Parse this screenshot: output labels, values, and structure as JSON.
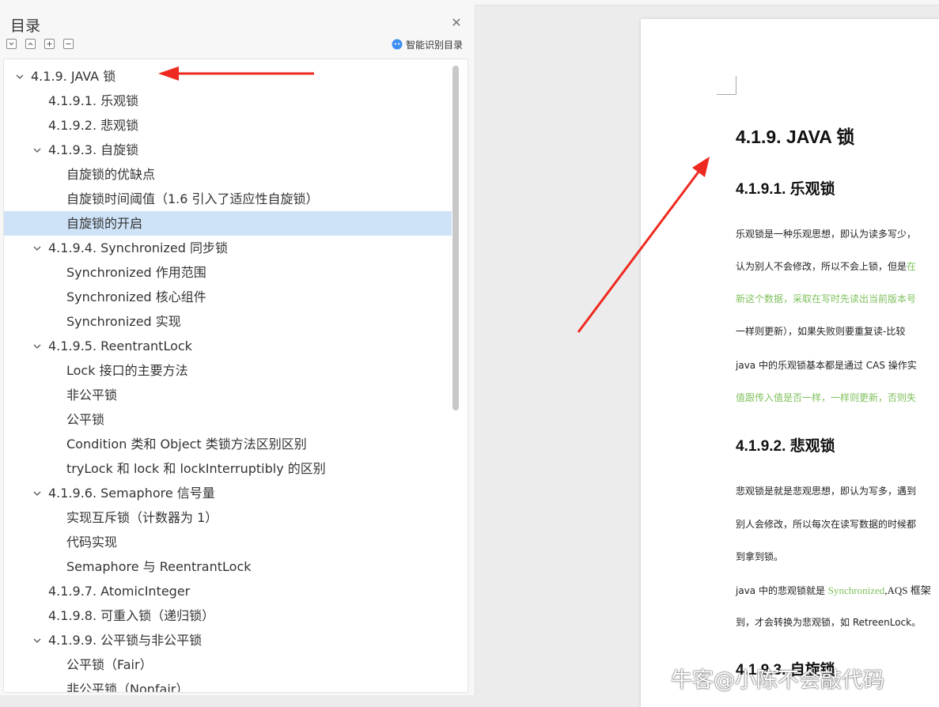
{
  "toc": {
    "title": "目录",
    "smart_label": "智能识别目录",
    "items": [
      {
        "label": "4.1.9. JAVA  锁",
        "level": 1,
        "expanded": true
      },
      {
        "label": "4.1.9.1.  乐观锁",
        "level": 2
      },
      {
        "label": "4.1.9.2.  悲观锁",
        "level": 2
      },
      {
        "label": "4.1.9.3.  自旋锁",
        "level": 2,
        "expanded": true
      },
      {
        "label": "自旋锁的优缺点",
        "level": 3
      },
      {
        "label": "自旋锁时间阈值（1.6  引入了适应性自旋锁）",
        "level": 3
      },
      {
        "label": "自旋锁的开启",
        "level": 3,
        "selected": true
      },
      {
        "label": "4.1.9.4. Synchronized  同步锁",
        "level": 2,
        "expanded": true
      },
      {
        "label": "Synchronized  作用范围",
        "level": 3
      },
      {
        "label": "Synchronized  核心组件",
        "level": 3
      },
      {
        "label": "Synchronized  实现",
        "level": 3
      },
      {
        "label": "4.1.9.5. ReentrantLock",
        "level": 2,
        "expanded": true
      },
      {
        "label": "Lock  接口的主要方法",
        "level": 3
      },
      {
        "label": "非公平锁",
        "level": 3
      },
      {
        "label": "公平锁",
        "level": 3
      },
      {
        "label": "Condition  类和  Object  类锁方法区别区别",
        "level": 3
      },
      {
        "label": "tryLock  和  lock  和  lockInterruptibly  的区别",
        "level": 3
      },
      {
        "label": "4.1.9.6. Semaphore  信号量",
        "level": 2,
        "expanded": true
      },
      {
        "label": "实现互斥锁（计数器为  1）",
        "level": 3
      },
      {
        "label": "代码实现",
        "level": 3
      },
      {
        "label": "Semaphore  与  ReentrantLock",
        "level": 3
      },
      {
        "label": "4.1.9.7. AtomicInteger",
        "level": 2
      },
      {
        "label": "4.1.9.8.  可重入锁（递归锁）",
        "level": 2
      },
      {
        "label": "4.1.9.9.  公平锁与非公平锁",
        "level": 2,
        "expanded": true
      },
      {
        "label": "公平锁（Fair）",
        "level": 3
      },
      {
        "label": "非公平锁（Nonfair）",
        "level": 3
      }
    ]
  },
  "doc": {
    "heading_main": "4.1.9. JAVA  锁",
    "h_optimistic": "4.1.9.1.  乐观锁",
    "p1_l1": "乐观锁是一种乐观思想，即认为读多写少，",
    "p1_l2a": "认为别人不会修改，所以不会上锁，但是",
    "p1_l2b": "在",
    "p1_l3": "新这个数据，采取在写时先读出当前版本号",
    "p1_l4": "一样则更新），如果失败则要重复读-比较",
    "p1_l5a": "java  中的乐观锁基本都是通过  CAS  操作实",
    "p1_l6": "值跟传入值是否一样，一样则更新，否则失",
    "h_pessimistic": "4.1.9.2.  悲观锁",
    "p2_l1": "悲观锁是就是悲观思想，即认为写多，遇到",
    "p2_l2": "别人会修改，所以每次在读写数据的时候都",
    "p2_l3": "到拿到锁。",
    "p2_l4a": "java 中的悲观锁就是 ",
    "p2_l4b": "Synchronized",
    "p2_l4c": ",AQS 框架",
    "p2_l5": "到，才会转换为悲观锁，如  RetreenLock。",
    "h_spin": "4.1.9.3.  自旋锁"
  },
  "watermark": "牛客@小陈不会敲代码",
  "colors": {
    "arrow": "#ee2a20",
    "selected_bg": "#cfe3f8",
    "green_text": "#7fc05c"
  }
}
